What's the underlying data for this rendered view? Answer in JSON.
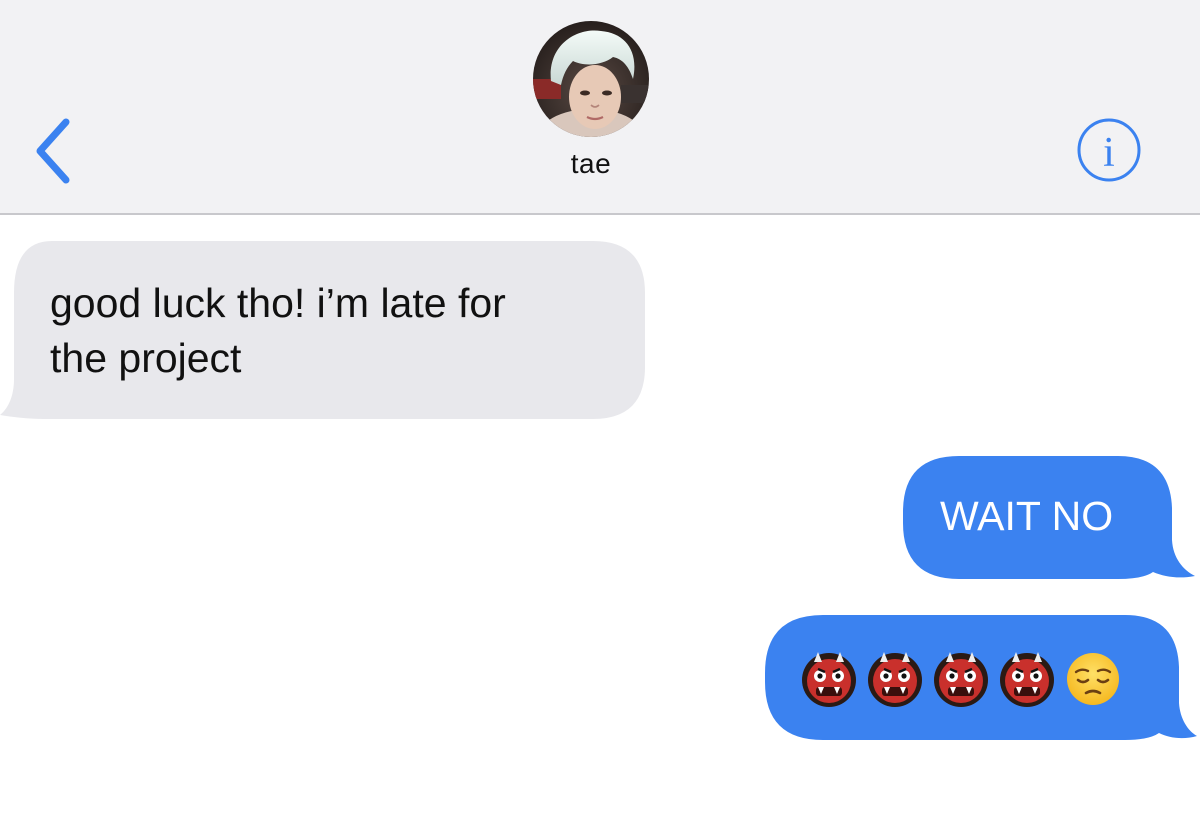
{
  "header": {
    "contact_name": "tae",
    "back_icon": "chevron-left-icon",
    "info_icon": "info-icon",
    "accent_color": "#3b82f0",
    "background_color": "#f2f2f4"
  },
  "messages": [
    {
      "direction": "incoming",
      "text": "good luck tho! i’m late for\nthe project",
      "bubble_color": "#e8e8ec"
    },
    {
      "direction": "outgoing",
      "text": "WAIT NO",
      "bubble_color": "#3b82f0"
    },
    {
      "direction": "outgoing",
      "emojis": [
        "ogre-emoji",
        "ogre-emoji",
        "ogre-emoji",
        "ogre-emoji",
        "pensive-face-emoji"
      ],
      "bubble_color": "#3b82f0"
    }
  ]
}
